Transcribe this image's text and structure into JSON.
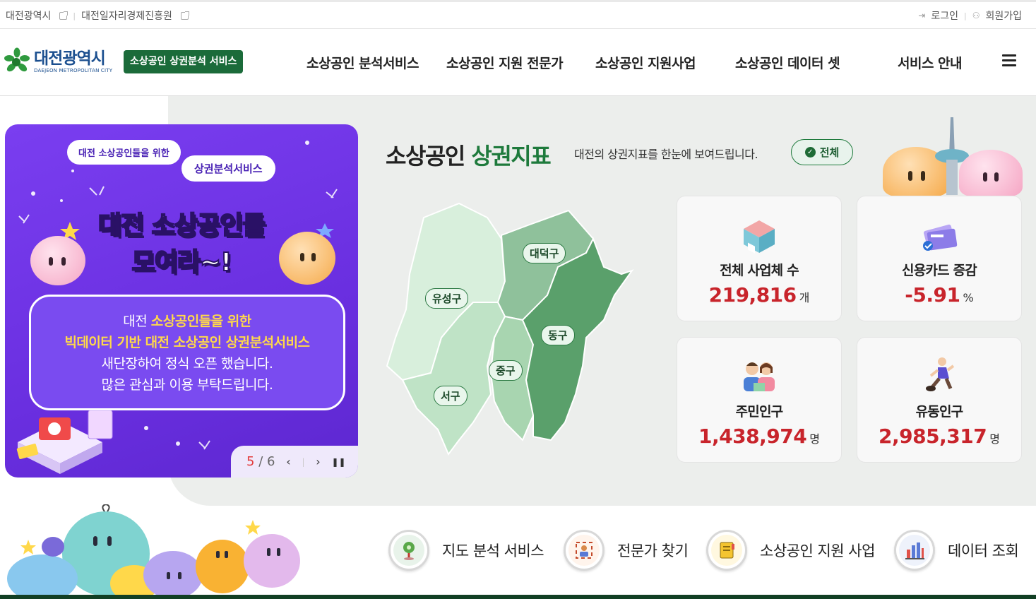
{
  "topbar": {
    "links": [
      "대전광역시",
      "대전일자리경제진흥원"
    ],
    "login": "로그인",
    "signup": "회원가입"
  },
  "header": {
    "logo_kr": "대전광역시",
    "logo_en": "DAEJEON METROPOLITAN CITY",
    "service_badge": "소상공인 상권분석 서비스",
    "nav": [
      "소상공인 분석서비스",
      "소상공인 지원 전문가",
      "소상공인 지원사업",
      "소상공인 데이터 셋",
      "서비스 안내"
    ]
  },
  "banner": {
    "bubble1": "대전 소상공인들을 위한",
    "bubble2": "상권분석서비스",
    "headline1": "대전 소상공인들",
    "headline2": "모여라~!",
    "line1_a": "대전 ",
    "line1_b": "소상공인들을 위한",
    "line2": "빅데이터 기반 대전 소상공인 상권분석서비스",
    "line3": "새단장하여 정식 오픈 했습니다.",
    "line4": "많은 관심과 이용 부탁드립니다.",
    "page_current": "5",
    "page_sep": "/",
    "page_total": "6"
  },
  "indicators": {
    "title_a": "소상공인 ",
    "title_b": "상권지표",
    "subtitle": "대전의 상권지표를 한눈에 보여드립니다.",
    "filter": "전체",
    "districts": [
      "대덕구",
      "유성구",
      "동구",
      "중구",
      "서구"
    ],
    "cards": [
      {
        "label": "전체 사업체 수",
        "value": "219,816",
        "unit": "개",
        "icon": "store-icon"
      },
      {
        "label": "신용카드 증감",
        "value": "-5.91",
        "unit": "%",
        "icon": "credit-card-icon"
      },
      {
        "label": "주민인구",
        "value": "1,438,974",
        "unit": "명",
        "icon": "residents-icon"
      },
      {
        "label": "유동인구",
        "value": "2,985,317",
        "unit": "명",
        "icon": "floating-population-icon"
      }
    ]
  },
  "quick_links": [
    {
      "label": "지도 분석 서비스",
      "icon": "map-pin-icon"
    },
    {
      "label": "전문가 찾기",
      "icon": "expert-icon"
    },
    {
      "label": "소상공인 지원 사업",
      "icon": "support-book-icon"
    },
    {
      "label": "데이터 조회",
      "icon": "bar-chart-icon"
    }
  ],
  "colors": {
    "brand_green": "#1e7a3c",
    "badge_green": "#1b6b3a",
    "banner_purple": "#6a2fe0",
    "stat_red": "#c8242b"
  }
}
